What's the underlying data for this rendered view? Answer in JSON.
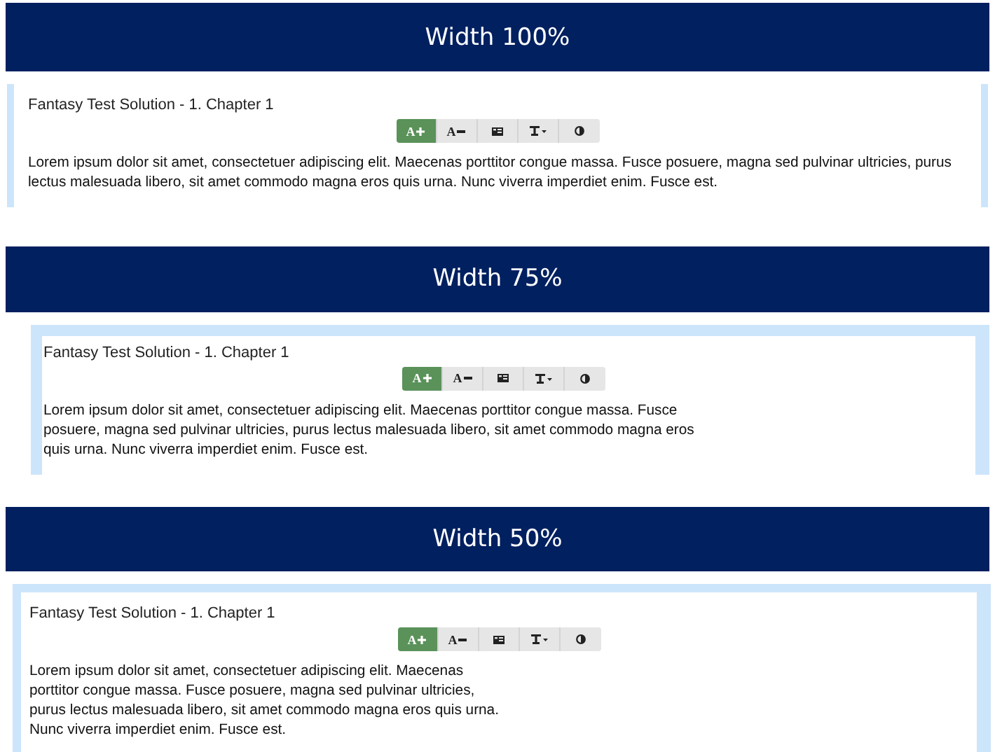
{
  "sections": [
    {
      "banner": "Width 100%",
      "title": "Fantasy Test Solution - 1. Chapter 1",
      "toolbar": [
        {
          "kind": "larger",
          "label": "A",
          "selected": true
        },
        {
          "kind": "smaller",
          "label": "A",
          "selected": false
        },
        {
          "kind": "layout",
          "selected": false
        },
        {
          "kind": "typeface",
          "selected": false
        },
        {
          "kind": "contrast",
          "selected": false
        }
      ],
      "text": "Lorem ipsum dolor sit amet, consectetuer adipiscing elit. Maecenas porttitor congue massa. Fusce posuere, magna sed pulvinar ultricies, purus lectus malesuada libero, sit amet commodo magna eros quis urna. Nunc viverra imperdiet enim. Fusce est."
    },
    {
      "banner": "Width 75%",
      "title": "Fantasy Test Solution - 1. Chapter 1",
      "toolbar": [
        {
          "kind": "larger",
          "label": "A",
          "selected": true
        },
        {
          "kind": "smaller",
          "label": "A",
          "selected": false
        },
        {
          "kind": "layout",
          "selected": false
        },
        {
          "kind": "typeface",
          "selected": false
        },
        {
          "kind": "contrast",
          "selected": false
        }
      ],
      "text": "Lorem ipsum dolor sit amet, consectetuer adipiscing elit. Maecenas porttitor congue massa. Fusce posuere, magna sed pulvinar ultricies, purus lectus malesuada libero, sit amet commodo magna eros quis urna. Nunc viverra imperdiet enim. Fusce est."
    },
    {
      "banner": "Width 50%",
      "title": "Fantasy Test Solution - 1. Chapter 1",
      "toolbar": [
        {
          "kind": "larger",
          "label": "A",
          "selected": true
        },
        {
          "kind": "smaller",
          "label": "A",
          "selected": false
        },
        {
          "kind": "layout",
          "selected": false
        },
        {
          "kind": "typeface",
          "selected": false
        },
        {
          "kind": "contrast",
          "selected": false
        }
      ],
      "text": "Lorem ipsum dolor sit amet, consectetuer adipiscing elit. Maecenas porttitor congue massa. Fusce posuere, magna sed pulvinar ultricies, purus lectus malesuada libero, sit amet commodo magna eros quis urna. Nunc viverra imperdiet enim. Fusce est."
    }
  ]
}
